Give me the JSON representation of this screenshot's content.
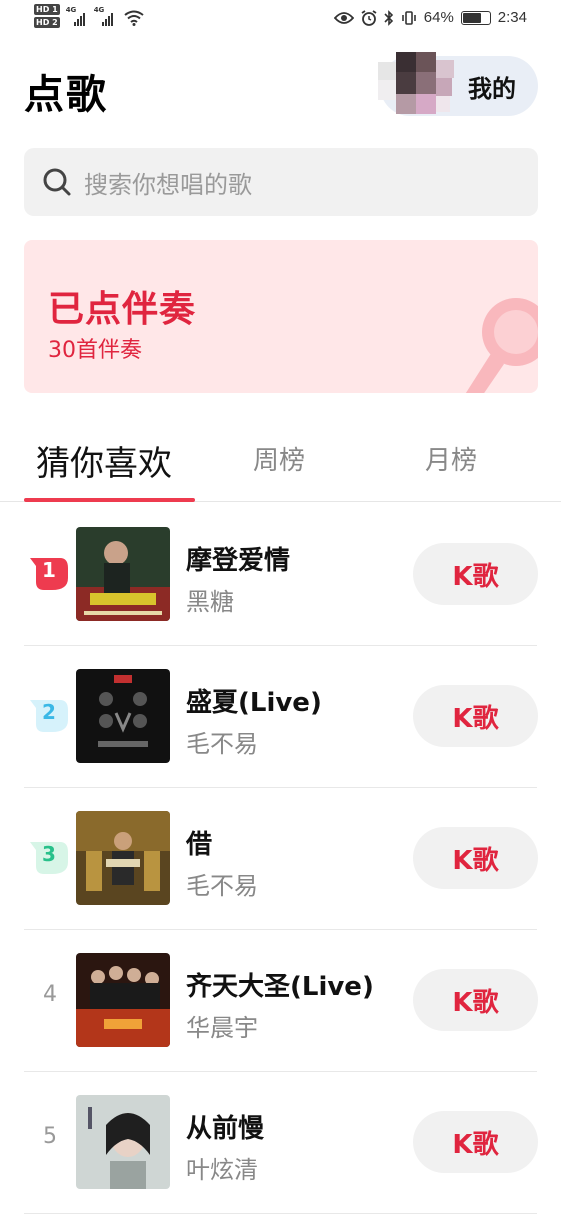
{
  "status_bar": {
    "hd1": "HD 1",
    "hd2": "HD 2",
    "net1": "4G",
    "net2": "4G",
    "battery_percent": "64%",
    "time": "2:34",
    "icons": [
      "eye-icon",
      "alarm-icon",
      "bluetooth-icon",
      "vibrate-icon",
      "battery-icon"
    ]
  },
  "header": {
    "title": "点歌",
    "mine_label": "我的"
  },
  "search": {
    "placeholder": "搜索你想唱的歌"
  },
  "banner": {
    "title": "已点伴奏",
    "subtitle": "30首伴奏",
    "accent_color": "#e0253f",
    "background_color": "#ffe7e8"
  },
  "tabs": [
    {
      "label": "猜你喜欢",
      "active": true
    },
    {
      "label": "周榜",
      "active": false
    },
    {
      "label": "月榜",
      "active": false
    }
  ],
  "songs": [
    {
      "rank": "1",
      "title": "摩登爱情",
      "artist": "黑糖",
      "button": "K歌"
    },
    {
      "rank": "2",
      "title": "盛夏(Live)",
      "artist": "毛不易",
      "button": "K歌"
    },
    {
      "rank": "3",
      "title": "借",
      "artist": "毛不易",
      "button": "K歌"
    },
    {
      "rank": "4",
      "title": "齐天大圣(Live)",
      "artist": "华晨宇",
      "button": "K歌"
    },
    {
      "rank": "5",
      "title": "从前慢",
      "artist": "叶炫清",
      "button": "K歌"
    }
  ],
  "colors": {
    "accent": "#ee3b4f",
    "rank1": "#ee3b4f",
    "rank2": "#3bb8e6",
    "rank3": "#27c08a"
  }
}
